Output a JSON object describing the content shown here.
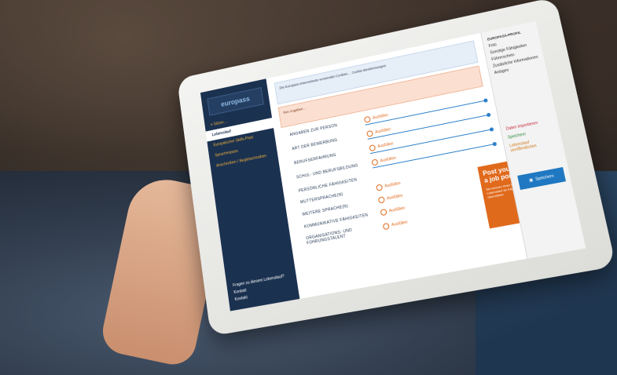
{
  "sidebar": {
    "logo": "europass",
    "sub": "≡ Sitzen…",
    "items": [
      {
        "label": "Lebenslauf"
      },
      {
        "label": "Europäischer Skills-Pass"
      },
      {
        "label": "Sprachenpass"
      },
      {
        "label": "Anschreiben / Begleitschreiben"
      }
    ],
    "bottom": [
      "Fragen zu diesem Lebenslauf?",
      "Kontakt",
      "Kontakt"
    ]
  },
  "main": {
    "cookie": "Die Europass-Internetseite verwendet Cookies… Cookie-Bestimmungen",
    "notice": "Ihre Angaben…",
    "rows": [
      {
        "label": "Angaben zur Person",
        "action": "Ausfüllen"
      },
      {
        "label": "Art der Bewerbung",
        "action": "Ausfüllen"
      },
      {
        "label": "Berufserfahrung",
        "action": "Ausfüllen"
      },
      {
        "label": "Schul- und Berufsbildung",
        "action": "Ausfüllen"
      },
      {
        "label": "Persönliche Fähigkeiten",
        "action": ""
      },
      {
        "label": "Muttersprache(n)",
        "action": "Ausfüllen"
      },
      {
        "label": "Weitere Sprache(n)",
        "action": "Ausfüllen"
      },
      {
        "label": "Kommunikative Fähigkeiten",
        "action": "Ausfüllen"
      },
      {
        "label": "Organisations- und Führungstalent",
        "action": "Ausfüllen"
      }
    ]
  },
  "right": {
    "header": "Europass-Profil",
    "items": [
      "Foto",
      "Sonstige Fähigkeiten",
      "Führerschein",
      "Zusätzliche Informationen",
      "Anlagen"
    ],
    "actions": [
      "Daten importieren",
      "Speichern",
      "Lebenslauf veröffentlichen"
    ],
    "save": "Speichern"
  },
  "promo": {
    "title": "Post your CV to a job portal",
    "small": "Sie können Ihren Europass-Lebenslauf an folgende Jobportale übermitteln"
  }
}
